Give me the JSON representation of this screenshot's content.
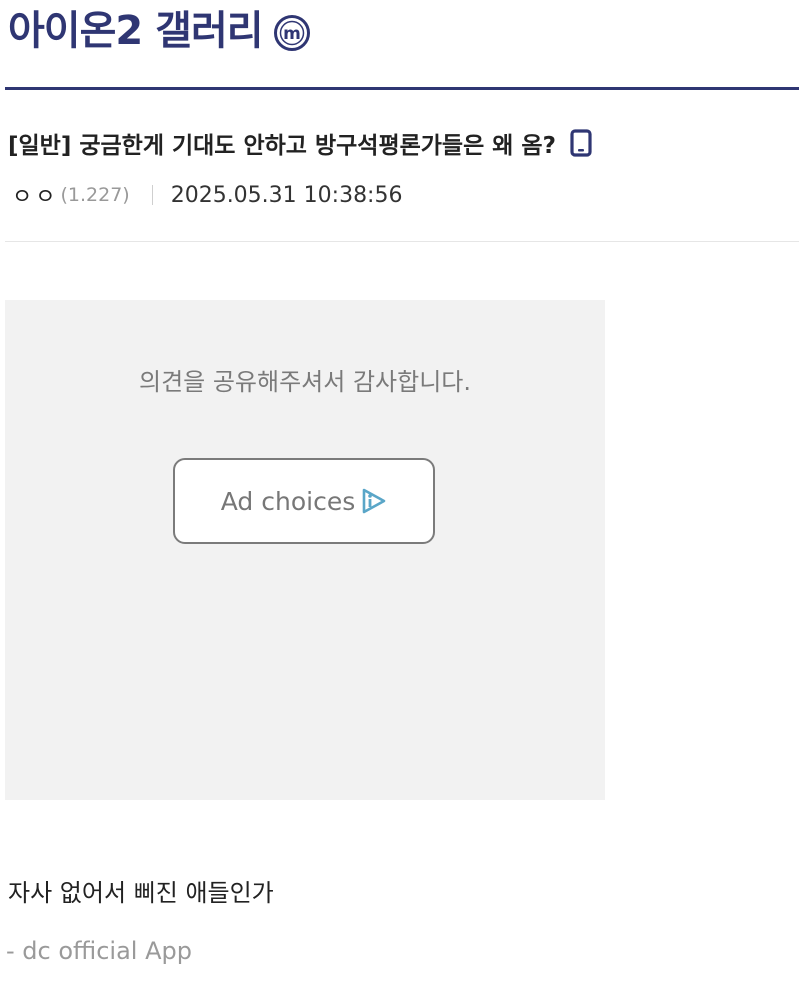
{
  "header": {
    "gallery_title": "아이온2 갤러리",
    "badge_letter": "m",
    "accent_color": "#2f3673"
  },
  "post": {
    "category": "[일반]",
    "subject": "궁금한게 기대도 안하고 방구석평론가들은 왜 옴?",
    "mobile_icon": "mobile-phone-icon",
    "author_nick": "ㅇㅇ",
    "author_ip": "(1.227)",
    "date": "2025.05.31 10:38:56",
    "body": "자사 없어서 삐진 애들인가",
    "signature": "- dc official App"
  },
  "ad": {
    "thanks_text": "의견을 공유해주셔서 감사합니다.",
    "choices_label": "Ad choices",
    "choices_icon": "adchoices-icon",
    "background": "#f2f2f2"
  }
}
